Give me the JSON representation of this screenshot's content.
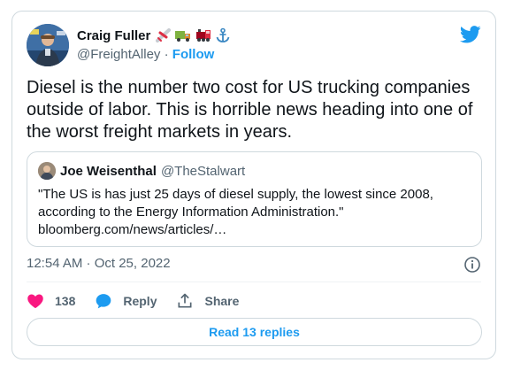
{
  "tweet": {
    "author": {
      "name": "Craig Fuller",
      "emojis": [
        "airplane-icon",
        "truck-icon",
        "train-icon",
        "anchor-icon"
      ],
      "handle": "@FreightAlley",
      "separator": " · ",
      "follow_label": "Follow"
    },
    "text": "Diesel is the number two cost for US trucking companies outside of labor. This is horrible news heading into one of the worst freight markets in years.",
    "quoted": {
      "name": "Joe Weisenthal",
      "handle": "@TheStalwart",
      "text": "\"The US is has just 25 days of diesel supply, the lowest since 2008, according to the Energy Information Administration.\"",
      "link": "bloomberg.com/news/articles/…"
    },
    "timestamp": "12:54 AM · Oct 25, 2022",
    "actions": {
      "like_count": "138",
      "reply_label": "Reply",
      "share_label": "Share"
    },
    "read_replies_label": "Read 13 replies"
  },
  "colors": {
    "twitter_blue": "#1d9bf0",
    "like_red": "#f91880",
    "text_primary": "#0f1419",
    "text_secondary": "#536471",
    "border": "#cfd9de"
  }
}
